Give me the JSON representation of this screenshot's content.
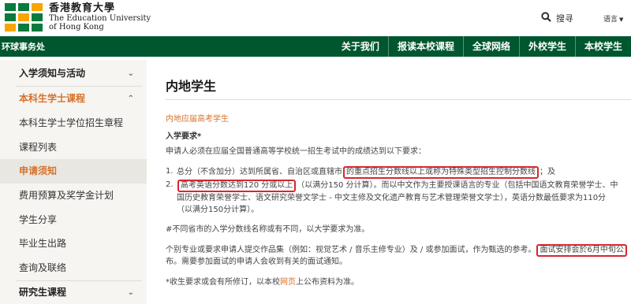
{
  "header": {
    "logo_zh": "香港教育大學",
    "logo_en_1": "The Education University",
    "logo_en_2": "of Hong Kong",
    "search_label": "搜寻",
    "language_label": "语言"
  },
  "nav": {
    "left_label": "环球事务处",
    "items": [
      "关于我们",
      "报读本校课程",
      "全球网络",
      "外校学生",
      "本校学生"
    ]
  },
  "sidebar": {
    "items": [
      {
        "label": "入学须知与活动"
      },
      {
        "label": "本科生学士课程"
      },
      {
        "label": "本科生学士学位招生章程"
      },
      {
        "label": "课程列表"
      },
      {
        "label": "申请须知"
      },
      {
        "label": "费用预算及奖学金计划"
      },
      {
        "label": "学生分享"
      },
      {
        "label": "毕业生出路"
      },
      {
        "label": "查询及联络"
      },
      {
        "label": "研究生课程"
      }
    ]
  },
  "main": {
    "title": "内地学生",
    "section_label": "内地应届高考学生",
    "req_title": "入学要求*",
    "intro": "申请人必须在应届全国普通高等学校统一招生考试中的成绩达到以下要求：",
    "item1": {
      "num": "1.",
      "pre": "总分（不含加分）达到所属省、自治区或直辖市",
      "highlight": "的重点招生分数线以上或称为特殊类型招生控制分数线",
      "post": "；及"
    },
    "item2": {
      "num": "2.",
      "highlight": "高考英语分数达到120 分或以上",
      "post": "（以满分150 分计算）。而以中文作为主要授课语言的专业（包括中国语文教育荣誉学士、中国历史教育荣誉学士、语文研究荣誉文学士 - 中文主修及文化遗产教育与艺术管理荣誉文学士），英语分数最低要求为110分（以满分150分计算）。"
    },
    "note1": "#不同省市的入学分数线名称或有不同，以大学要求为准。",
    "interview_pre": "个别专业或要求申请人提交作品集（例如：视觉艺术 / 音乐主修专业）及 / 或参加面试，作为甄选的参考。",
    "interview_highlight": "面试安排会於6月中旬公",
    "interview_line2": "布。需要参加面试的申请人会收到有关的面试通知。",
    "footnote_pre": "*收生要求或会有所修订，以本校",
    "footnote_link": "网页",
    "footnote_post": "上公布资料为准。"
  },
  "colors": {
    "brand_green": "#00562f",
    "accent_orange": "#d4722c",
    "highlight_red": "#d9262c"
  },
  "icons": {
    "search": "search-icon",
    "chevron": "chevron-down-icon"
  }
}
